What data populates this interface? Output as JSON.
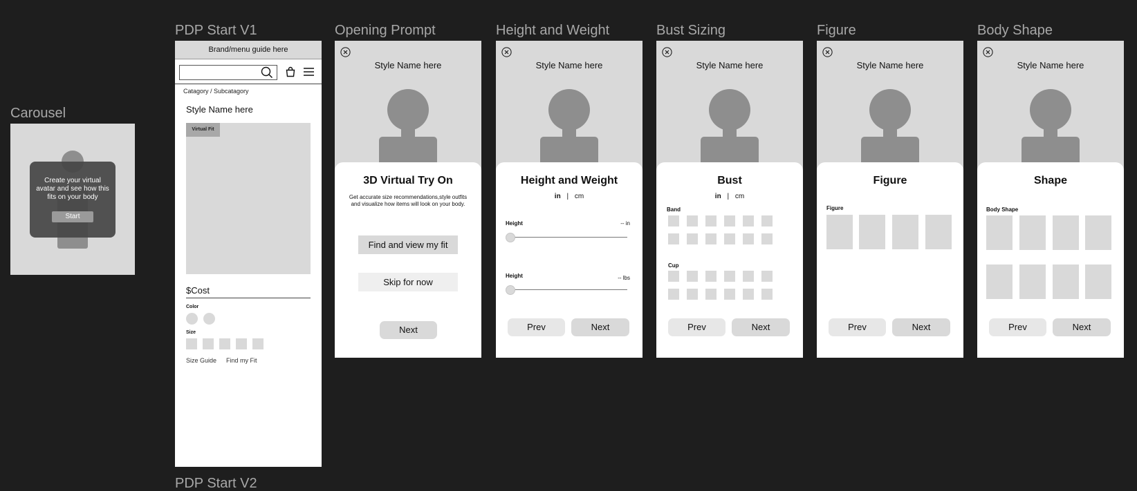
{
  "carousel": {
    "label": "Carousel",
    "prompt": "Create your virtual avatar and see how this fits on your body",
    "start_label": "Start"
  },
  "pdp": {
    "label": "PDP Start V1",
    "top_bar": "Brand/menu guide here",
    "breadcrumb": "Catagory / Subcatagory",
    "style_name": "Style Name here",
    "badge": "Virtual Fit",
    "cost": "$Cost",
    "color_label": "Color",
    "size_label": "Size",
    "size_guide": "Size Guide",
    "find_fit": "Find my Fit"
  },
  "pdp_v2_label": "PDP Start V2",
  "common": {
    "style_name": "Style Name here",
    "prev": "Prev",
    "next": "Next"
  },
  "opening": {
    "label": "Opening Prompt",
    "title": "3D Virtual Try On",
    "desc": "Get accurate size recommendations,style outfits and visualize how items will look on your body.",
    "find_btn": "Find and view my fit",
    "skip_btn": "Skip for now",
    "next_btn": "Next"
  },
  "height_weight": {
    "label": "Height and Weight",
    "title": "Height and Weight",
    "unit_in": "in",
    "unit_sep": "|",
    "unit_cm": "cm",
    "height_label": "Height",
    "height_value": "-- in",
    "weight_label": "Height",
    "weight_value": "-- lbs"
  },
  "bust": {
    "label": "Bust Sizing",
    "title": "Bust",
    "unit_in": "in",
    "unit_sep": "|",
    "unit_cm": "cm",
    "band_label": "Band",
    "cup_label": "Cup"
  },
  "figure": {
    "label": "Figure",
    "title": "Figure",
    "section": "Figure"
  },
  "body_shape": {
    "label": "Body Shape",
    "title": "Shape",
    "section": "Body Shape"
  },
  "colors": {
    "canvas": "#1e1e1e",
    "placeholder": "#d9d9d9",
    "avatar": "#8e8e8e"
  }
}
